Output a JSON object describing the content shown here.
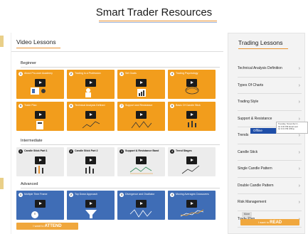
{
  "header": {
    "title": "Smart Trader Resources"
  },
  "video_lessons": {
    "title": "Video Lessons",
    "groups": [
      {
        "label": "Beginner",
        "color": "#f29d1c",
        "cards": [
          {
            "num": "1",
            "title": "About Pro-user Academy"
          },
          {
            "num": "2",
            "title": "Trading is a Profession"
          },
          {
            "num": "3",
            "title": "Set Goals"
          },
          {
            "num": "4",
            "title": "Trading Psychology"
          },
          {
            "num": "5",
            "title": "Trade Plan"
          },
          {
            "num": "6",
            "title": "Technical Analysis Defined"
          },
          {
            "num": "7",
            "title": "Support and Resistance"
          },
          {
            "num": "8",
            "title": "Basic Of Candle Stick"
          }
        ]
      },
      {
        "label": "Intermediate",
        "color": "#ececec",
        "cards": [
          {
            "num": "1",
            "title": "Candle Stick Part 1"
          },
          {
            "num": "2",
            "title": "Candle Stick Part 2"
          },
          {
            "num": "3",
            "title": "Support & Resistance Band"
          },
          {
            "num": "4",
            "title": "Trend Stages"
          }
        ]
      },
      {
        "label": "Advanced",
        "color": "#3f6db6",
        "cards": [
          {
            "num": "1",
            "title": "Multiple Time Frame"
          },
          {
            "num": "2",
            "title": "Top Down Approach"
          },
          {
            "num": "3",
            "title": "Divergence and Oscillator"
          },
          {
            "num": "4",
            "title": "Moving Averages Crossovers"
          }
        ]
      }
    ],
    "attend_button": {
      "prefix": "I want to",
      "emph": "ATTEND"
    }
  },
  "trading_lessons": {
    "title": "Trading Lessons",
    "items": [
      "Technical Analysis Definition",
      "Types Of Charts",
      "Trading Style",
      "Support & Resistance",
      "Trends",
      "Candle Stick",
      "Single Candle Pattern",
      "Double Candle Pattern",
      "Risk Management",
      "Trade Plan"
    ],
    "more_label": "More",
    "read_button": {
      "prefix": "I want to",
      "emph": "READ"
    }
  },
  "popup": {
    "offline_label": "Offline",
    "tooltip_lines": [
      "Tuesday, November 2...",
      "Ist 3:30 PM Email sent",
      "Ist 3:31 PM Offline"
    ]
  },
  "colors": {
    "accent": "#f29d1c",
    "blue": "#3f6db6",
    "button": "#f0a73d"
  }
}
